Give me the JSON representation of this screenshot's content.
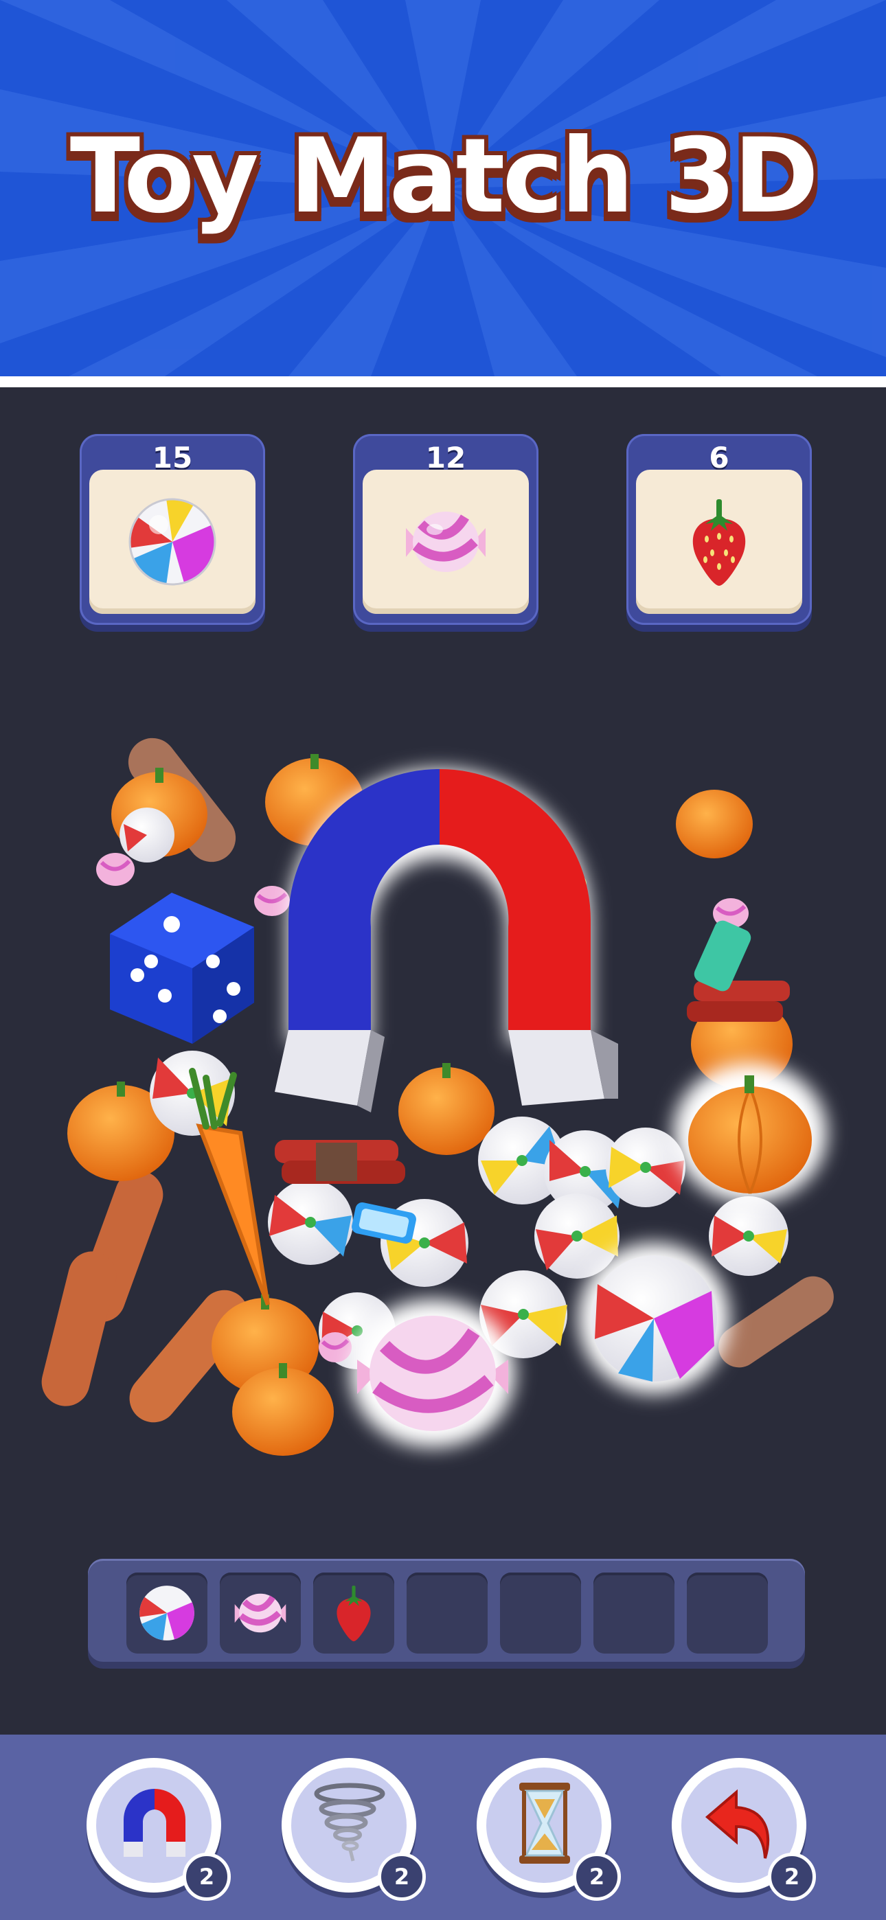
{
  "header": {
    "title": "Toy Match 3D",
    "background_color": "#1f55d6"
  },
  "goals": [
    {
      "count": "15",
      "item": "beach-ball"
    },
    {
      "count": "12",
      "item": "candy"
    },
    {
      "count": "6",
      "item": "strawberry"
    }
  ],
  "tray": {
    "slot_count": 7,
    "slots": [
      "beach-ball",
      "candy",
      "strawberry",
      "",
      "",
      "",
      ""
    ]
  },
  "boosters": [
    {
      "name": "magnet",
      "icon": "magnet-icon",
      "count": "2"
    },
    {
      "name": "tornado",
      "icon": "tornado-icon",
      "count": "2"
    },
    {
      "name": "hourglass",
      "icon": "hourglass-icon",
      "count": "2"
    },
    {
      "name": "undo",
      "icon": "undo-arrow-icon",
      "count": "2"
    }
  ],
  "colors": {
    "board": "#2a2c3a",
    "goal_card": "#3f4a9c",
    "tray": "#4d5488",
    "booster_bar": "#5a63a4"
  }
}
